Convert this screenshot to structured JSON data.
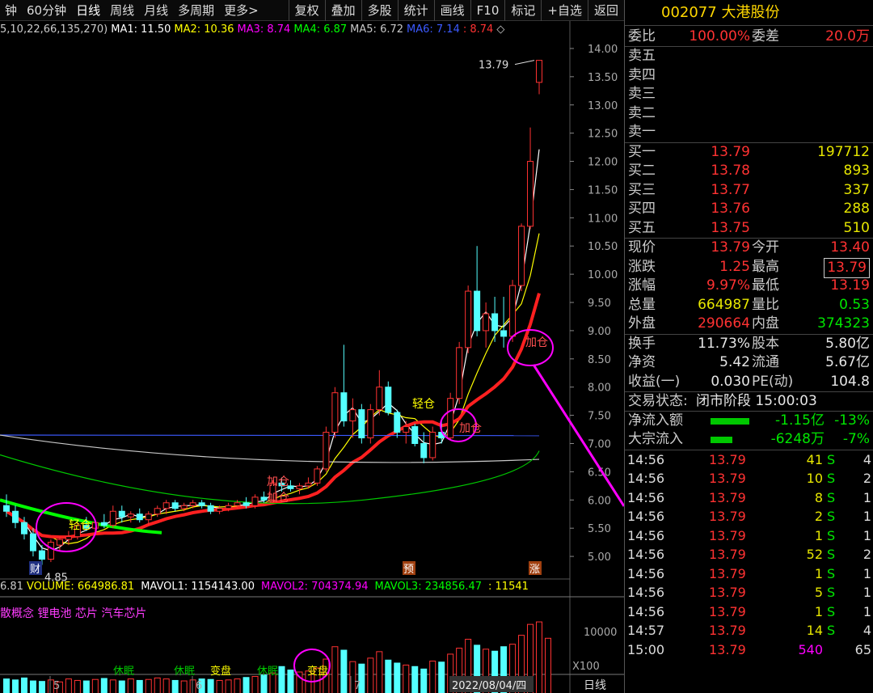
{
  "toolbar": {
    "period_tabs": [
      "钟",
      "60分钟",
      "日线",
      "周线",
      "月线",
      "多周期",
      "更多>"
    ],
    "active_tab": "日线",
    "actions": [
      "复权",
      "叠加",
      "多股",
      "统计",
      "画线",
      "F10",
      "标记",
      "+自选",
      "返回"
    ]
  },
  "ma_line": {
    "params": "5,10,22,66,135,270)",
    "items": [
      {
        "label": "MA1:",
        "value": "11.50",
        "color": "#ffffff"
      },
      {
        "label": "MA2:",
        "value": "10.36",
        "color": "#ffff00"
      },
      {
        "label": "MA3:",
        "value": "8.74",
        "color": "#ff00ff"
      },
      {
        "label": "MA4:",
        "value": "6.87",
        "color": "#00ff00"
      },
      {
        "label": "MA5:",
        "value": "6.72",
        "color": "#c8c8c8"
      },
      {
        "label": "MA6:",
        "value": "7.14",
        "color": "#3c5aff"
      },
      {
        "label": ":",
        "value": "8.74",
        "color": "#ff3232"
      }
    ]
  },
  "price_axis": {
    "ticks": [
      "14.00",
      "13.50",
      "13.00",
      "12.50",
      "12.00",
      "11.50",
      "11.00",
      "10.50",
      "10.00",
      "9.50",
      "9.00",
      "8.50",
      "8.00",
      "7.50",
      "7.00",
      "6.50",
      "6.00",
      "5.50",
      "5.00"
    ]
  },
  "annotations": {
    "high_label": "13.79",
    "low_label": "4.85",
    "markers": [
      "财",
      "预",
      "涨"
    ],
    "signals": [
      "轻仓",
      "加仓",
      "加仓",
      "轻仓",
      "加仓",
      "加仓"
    ],
    "vol_signals": [
      "休眠",
      "休眠",
      "变盘",
      "休眠",
      "变盘"
    ]
  },
  "volume_line": {
    "prefix": "6.81",
    "items": [
      {
        "label": "VOLUME:",
        "value": "664986.81",
        "color": "#ffff00"
      },
      {
        "label": "MAVOL1:",
        "value": "1154143.00",
        "color": "#ffffff"
      },
      {
        "label": "MAVOL2:",
        "value": "704374.94",
        "color": "#ff00ff"
      },
      {
        "label": "MAVOL3:",
        "value": "234856.47",
        "color": "#00ff00"
      },
      {
        "label": ":",
        "value": "11541",
        "color": "#ffff00"
      }
    ]
  },
  "concepts": "散概念 锂电池 芯片 汽车芯片",
  "volume_axis": {
    "tick": "10000",
    "unit": "X100"
  },
  "date_axis": {
    "labels": [
      "5",
      "6",
      "7"
    ],
    "current_date": "2022/08/04/四",
    "period": "日线"
  },
  "stock": {
    "code": "002077",
    "name": "大港股份"
  },
  "order_ratio": {
    "label": "委比",
    "value": "100.00%",
    "diff_label": "委差",
    "diff_value": "20.0万"
  },
  "asks": [
    {
      "label": "卖五",
      "price": "",
      "vol": ""
    },
    {
      "label": "卖四",
      "price": "",
      "vol": ""
    },
    {
      "label": "卖三",
      "price": "",
      "vol": ""
    },
    {
      "label": "卖二",
      "price": "",
      "vol": ""
    },
    {
      "label": "卖一",
      "price": "",
      "vol": ""
    }
  ],
  "bids": [
    {
      "label": "买一",
      "price": "13.79",
      "vol": "197712"
    },
    {
      "label": "买二",
      "price": "13.78",
      "vol": "893"
    },
    {
      "label": "买三",
      "price": "13.77",
      "vol": "337"
    },
    {
      "label": "买四",
      "price": "13.76",
      "vol": "288"
    },
    {
      "label": "买五",
      "price": "13.75",
      "vol": "510"
    }
  ],
  "quote": [
    {
      "l1": "现价",
      "v1": "13.79",
      "c1": "red",
      "l2": "今开",
      "v2": "13.40",
      "c2": "red"
    },
    {
      "l1": "涨跌",
      "v1": "1.25",
      "c1": "red",
      "l2": "最高",
      "v2": "13.79",
      "c2": "red",
      "box": true
    },
    {
      "l1": "涨幅",
      "v1": "9.97%",
      "c1": "red",
      "l2": "最低",
      "v2": "13.19",
      "c2": "red"
    },
    {
      "l1": "总量",
      "v1": "664987",
      "c1": "yellow",
      "l2": "量比",
      "v2": "0.53",
      "c2": "green"
    },
    {
      "l1": "外盘",
      "v1": "290664",
      "c1": "red",
      "l2": "内盘",
      "v2": "374323",
      "c2": "green"
    }
  ],
  "fundamentals": [
    {
      "l1": "换手",
      "v1": "11.73%",
      "l2": "股本",
      "v2": "5.80亿"
    },
    {
      "l1": "净资",
      "v1": "5.42",
      "l2": "流通",
      "v2": "5.67亿"
    },
    {
      "l1": "收益(一)",
      "v1": "0.030",
      "l2": "PE(动)",
      "v2": "104.8"
    }
  ],
  "trade_status": {
    "label": "交易状态:",
    "value": "闭市阶段 15:00:03"
  },
  "flows": [
    {
      "label": "净流入额",
      "value": "-1.15亿",
      "pct": "-13%",
      "bar": 0.8
    },
    {
      "label": "大宗流入",
      "value": "-6248万",
      "pct": "-7%",
      "bar": 0.45
    }
  ],
  "ticks": [
    {
      "time": "14:56",
      "price": "13.79",
      "vol": "41",
      "side": "S",
      "n": "4"
    },
    {
      "time": "14:56",
      "price": "13.79",
      "vol": "10",
      "side": "S",
      "n": "2"
    },
    {
      "time": "14:56",
      "price": "13.79",
      "vol": "8",
      "side": "S",
      "n": "1"
    },
    {
      "time": "14:56",
      "price": "13.79",
      "vol": "2",
      "side": "S",
      "n": "1"
    },
    {
      "time": "14:56",
      "price": "13.79",
      "vol": "1",
      "side": "S",
      "n": "1"
    },
    {
      "time": "14:56",
      "price": "13.79",
      "vol": "52",
      "side": "S",
      "n": "2"
    },
    {
      "time": "14:56",
      "price": "13.79",
      "vol": "1",
      "side": "S",
      "n": "1"
    },
    {
      "time": "14:56",
      "price": "13.79",
      "vol": "5",
      "side": "S",
      "n": "1"
    },
    {
      "time": "14:56",
      "price": "13.79",
      "vol": "1",
      "side": "S",
      "n": "1"
    },
    {
      "time": "14:57",
      "price": "13.79",
      "vol": "14",
      "side": "S",
      "n": "4"
    },
    {
      "time": "15:00",
      "price": "13.79",
      "vol": "540",
      "side": "",
      "n": "65"
    }
  ],
  "chart_data": {
    "type": "candlestick",
    "ylim": [
      4.6,
      14.2
    ],
    "candles": [
      {
        "o": 5.9,
        "h": 6.1,
        "l": 5.7,
        "c": 5.8
      },
      {
        "o": 5.8,
        "h": 5.9,
        "l": 5.5,
        "c": 5.6
      },
      {
        "o": 5.6,
        "h": 5.7,
        "l": 5.3,
        "c": 5.4
      },
      {
        "o": 5.4,
        "h": 5.5,
        "l": 5.0,
        "c": 5.1
      },
      {
        "o": 5.1,
        "h": 5.2,
        "l": 4.85,
        "c": 4.95
      },
      {
        "o": 4.95,
        "h": 5.3,
        "l": 4.9,
        "c": 5.25
      },
      {
        "o": 5.2,
        "h": 5.35,
        "l": 5.1,
        "c": 5.3
      },
      {
        "o": 5.3,
        "h": 5.45,
        "l": 5.2,
        "c": 5.35
      },
      {
        "o": 5.35,
        "h": 5.6,
        "l": 5.3,
        "c": 5.55
      },
      {
        "o": 5.55,
        "h": 5.7,
        "l": 5.45,
        "c": 5.5
      },
      {
        "o": 5.5,
        "h": 5.65,
        "l": 5.4,
        "c": 5.6
      },
      {
        "o": 5.6,
        "h": 5.75,
        "l": 5.5,
        "c": 5.55
      },
      {
        "o": 5.55,
        "h": 5.9,
        "l": 5.5,
        "c": 5.8
      },
      {
        "o": 5.8,
        "h": 5.9,
        "l": 5.6,
        "c": 5.7
      },
      {
        "o": 5.7,
        "h": 5.8,
        "l": 5.6,
        "c": 5.75
      },
      {
        "o": 5.75,
        "h": 5.85,
        "l": 5.6,
        "c": 5.65
      },
      {
        "o": 5.65,
        "h": 5.8,
        "l": 5.55,
        "c": 5.75
      },
      {
        "o": 5.75,
        "h": 5.9,
        "l": 5.7,
        "c": 5.85
      },
      {
        "o": 5.85,
        "h": 6.0,
        "l": 5.75,
        "c": 5.95
      },
      {
        "o": 5.95,
        "h": 6.0,
        "l": 5.8,
        "c": 5.85
      },
      {
        "o": 5.85,
        "h": 5.95,
        "l": 5.8,
        "c": 5.9
      },
      {
        "o": 5.9,
        "h": 6.0,
        "l": 5.85,
        "c": 5.95
      },
      {
        "o": 5.95,
        "h": 6.0,
        "l": 5.85,
        "c": 5.9
      },
      {
        "o": 5.9,
        "h": 5.95,
        "l": 5.75,
        "c": 5.8
      },
      {
        "o": 5.8,
        "h": 5.9,
        "l": 5.75,
        "c": 5.85
      },
      {
        "o": 5.85,
        "h": 5.95,
        "l": 5.8,
        "c": 5.9
      },
      {
        "o": 5.9,
        "h": 6.0,
        "l": 5.85,
        "c": 5.95
      },
      {
        "o": 5.95,
        "h": 6.05,
        "l": 5.85,
        "c": 5.9
      },
      {
        "o": 5.9,
        "h": 6.1,
        "l": 5.85,
        "c": 6.05
      },
      {
        "o": 6.05,
        "h": 6.15,
        "l": 5.95,
        "c": 6.0
      },
      {
        "o": 6.0,
        "h": 6.35,
        "l": 5.95,
        "c": 6.3
      },
      {
        "o": 6.3,
        "h": 6.4,
        "l": 6.15,
        "c": 6.25
      },
      {
        "o": 6.25,
        "h": 6.35,
        "l": 6.15,
        "c": 6.2
      },
      {
        "o": 6.2,
        "h": 6.3,
        "l": 6.1,
        "c": 6.25
      },
      {
        "o": 6.25,
        "h": 6.4,
        "l": 6.2,
        "c": 6.3
      },
      {
        "o": 6.3,
        "h": 6.6,
        "l": 6.25,
        "c": 6.55
      },
      {
        "o": 6.55,
        "h": 7.3,
        "l": 6.5,
        "c": 7.2
      },
      {
        "o": 7.2,
        "h": 8.0,
        "l": 7.1,
        "c": 7.9
      },
      {
        "o": 7.9,
        "h": 8.75,
        "l": 7.3,
        "c": 7.4
      },
      {
        "o": 7.4,
        "h": 7.8,
        "l": 7.1,
        "c": 7.6
      },
      {
        "o": 7.6,
        "h": 7.7,
        "l": 7.0,
        "c": 7.1
      },
      {
        "o": 7.1,
        "h": 7.7,
        "l": 7.0,
        "c": 7.6
      },
      {
        "o": 7.6,
        "h": 8.3,
        "l": 7.5,
        "c": 8.0
      },
      {
        "o": 8.0,
        "h": 8.1,
        "l": 7.5,
        "c": 7.55
      },
      {
        "o": 7.55,
        "h": 7.6,
        "l": 7.1,
        "c": 7.2
      },
      {
        "o": 7.2,
        "h": 7.4,
        "l": 7.0,
        "c": 7.3
      },
      {
        "o": 7.3,
        "h": 7.35,
        "l": 6.95,
        "c": 7.0
      },
      {
        "o": 7.0,
        "h": 7.2,
        "l": 6.65,
        "c": 6.75
      },
      {
        "o": 6.75,
        "h": 7.3,
        "l": 6.7,
        "c": 7.2
      },
      {
        "o": 7.2,
        "h": 7.4,
        "l": 7.0,
        "c": 7.1
      },
      {
        "o": 7.1,
        "h": 7.9,
        "l": 7.05,
        "c": 7.8
      },
      {
        "o": 7.8,
        "h": 8.8,
        "l": 7.7,
        "c": 8.7
      },
      {
        "o": 8.7,
        "h": 9.8,
        "l": 8.6,
        "c": 9.7
      },
      {
        "o": 9.7,
        "h": 10.5,
        "l": 8.9,
        "c": 9.0
      },
      {
        "o": 9.0,
        "h": 9.5,
        "l": 8.7,
        "c": 9.3
      },
      {
        "o": 9.3,
        "h": 9.6,
        "l": 8.8,
        "c": 9.0
      },
      {
        "o": 9.0,
        "h": 9.6,
        "l": 8.7,
        "c": 8.9
      },
      {
        "o": 8.9,
        "h": 9.9,
        "l": 8.8,
        "c": 9.8
      },
      {
        "o": 9.8,
        "h": 10.9,
        "l": 9.7,
        "c": 10.85
      },
      {
        "o": 10.85,
        "h": 12.6,
        "l": 10.8,
        "c": 12.0
      },
      {
        "o": 13.4,
        "h": 13.79,
        "l": 13.19,
        "c": 13.79
      }
    ],
    "volume": [
      30,
      28,
      32,
      26,
      25,
      28,
      24,
      30,
      27,
      26,
      29,
      31,
      28,
      26,
      30,
      27,
      29,
      32,
      30,
      27,
      26,
      28,
      30,
      29,
      27,
      28,
      30,
      33,
      35,
      38,
      42,
      55,
      48,
      44,
      46,
      52,
      70,
      95,
      88,
      65,
      60,
      72,
      85,
      68,
      62,
      58,
      55,
      50,
      66,
      64,
      80,
      92,
      110,
      98,
      90,
      86,
      95,
      100,
      118,
      140,
      145,
      112
    ],
    "vol_ylim": [
      0,
      150
    ]
  }
}
